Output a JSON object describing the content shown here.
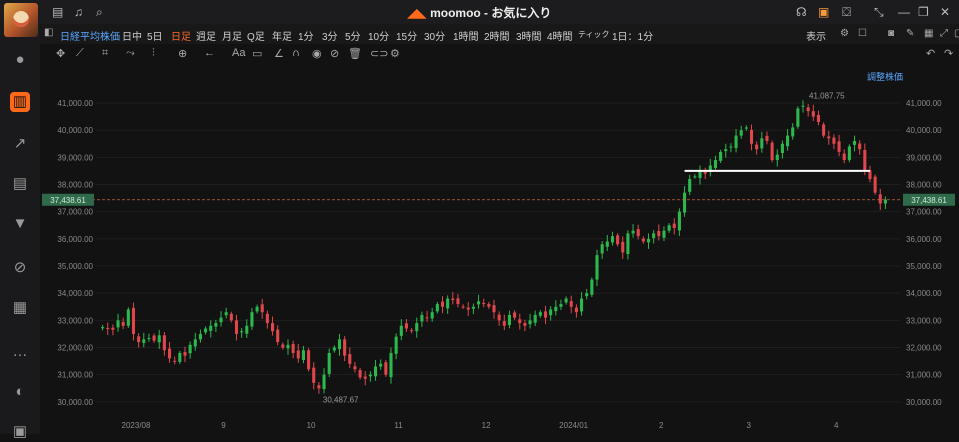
{
  "app": {
    "title": "moomoo - お気に入り",
    "logo_icon": "moomoo-logo-icon",
    "brand_color": "#ff6a1a"
  },
  "topbar": {
    "left_icons": [
      "layout-icon",
      "bell-icon",
      "search-icon"
    ],
    "right_icons": [
      "headset-icon",
      "lock-icon",
      "shirt-icon",
      "collapse-icon",
      "minimize-icon",
      "restore-icon",
      "close-icon"
    ]
  },
  "sidebar": {
    "items": [
      "user-icon",
      "chart-icon",
      "trend-icon",
      "news-icon",
      "filter-icon",
      "options-icon",
      "document-icon",
      "chat-icon",
      "moon-icon",
      "more-icon"
    ],
    "active_index": 1
  },
  "timeframes": {
    "symbol": "日経平均株価",
    "items": [
      "日中",
      "5日",
      "日足",
      "週足",
      "月足",
      "Q足",
      "年足",
      "1分",
      "3分",
      "5分",
      "10分",
      "15分",
      "30分",
      "1時間",
      "2時間",
      "3時間",
      "4時間",
      "ティック",
      "1日：1分"
    ],
    "active": "日足"
  },
  "toolbar_right": {
    "display_label": "表示",
    "icons": [
      "settings-icon",
      "square-icon",
      "camera-icon",
      "pen-icon",
      "grid-icon",
      "expand-icon",
      "fullscreen-icon"
    ]
  },
  "drawing_tools": [
    "crosshair-icon",
    "line-icon",
    "rect-icon",
    "path-icon",
    "bar-icon",
    "measure-icon",
    "arrow-icon",
    "text-icon",
    "note-icon",
    "angle-icon",
    "magnet-icon",
    "eye-icon",
    "eye-off-icon",
    "trash-icon",
    "link-icon",
    "gear-icon"
  ],
  "chart_header": {
    "adjust_label": "調整株価"
  },
  "chart_data": {
    "type": "candlestick",
    "instrument": "日経平均株価",
    "interval": "日足",
    "ylim": [
      29700,
      41700
    ],
    "y_ticks": [
      "30,000.00",
      "31,000.00",
      "32,000.00",
      "33,000.00",
      "34,000.00",
      "35,000.00",
      "36,000.00",
      "37,000.00",
      "38,000.00",
      "39,000.00",
      "40,000.00",
      "41,000.00"
    ],
    "x_labels": [
      "2023/08",
      "9",
      "10",
      "11",
      "12",
      "2024/01",
      "2",
      "3",
      "4"
    ],
    "current_price": "37,438.61",
    "current_value": 37438.61,
    "high_label": "41,087.75",
    "high_value": 41087.75,
    "low_label": "30,487.67",
    "low_value": 30487.67,
    "trendline_level": 38500,
    "colors": {
      "up": "#2db84e",
      "down": "#e0474c",
      "trendline": "#ffffff",
      "price_line": "#c8663a",
      "price_label_bg": "#2f6b4a"
    },
    "series": [
      32750,
      32700,
      32650,
      33000,
      32800,
      33400,
      32500,
      32200,
      32300,
      32350,
      32250,
      32450,
      31900,
      31600,
      31500,
      31800,
      31700,
      32100,
      32300,
      32500,
      32700,
      32800,
      32900,
      33100,
      33300,
      33000,
      32500,
      32600,
      32800,
      33300,
      33500,
      33300,
      32900,
      32600,
      32200,
      32000,
      32100,
      31800,
      31600,
      31900,
      31200,
      30700,
      30500,
      31000,
      31800,
      32000,
      32300,
      31700,
      31400,
      31200,
      30900,
      30850,
      31000,
      31300,
      31400,
      31000,
      31800,
      32400,
      32800,
      32700,
      32600,
      32900,
      33200,
      33100,
      33300,
      33600,
      33500,
      33800,
      33750,
      33600,
      33500,
      33400,
      33500,
      33700,
      33600,
      33500,
      33300,
      33000,
      32800,
      33200,
      33100,
      32900,
      32800,
      33000,
      33200,
      33300,
      33100,
      33400,
      33500,
      33600,
      33800,
      33500,
      33300,
      33800,
      34000,
      34500,
      35400,
      35800,
      35900,
      36100,
      35800,
      35500,
      36200,
      36300,
      36100,
      35900,
      36000,
      36200,
      36100,
      36300,
      36500,
      36400,
      37000,
      37700,
      38200,
      38300,
      38500,
      38400,
      38700,
      38900,
      39200,
      39300,
      39400,
      39800,
      40000,
      40100,
      39500,
      39300,
      39700,
      39600,
      38900,
      39100,
      39500,
      39800,
      40100,
      40800,
      40900,
      40700,
      40500,
      40300,
      39800,
      39700,
      39500,
      39200,
      38900,
      39400,
      39600,
      39300,
      38500,
      38200,
      37700,
      37300,
      37438.61
    ]
  }
}
